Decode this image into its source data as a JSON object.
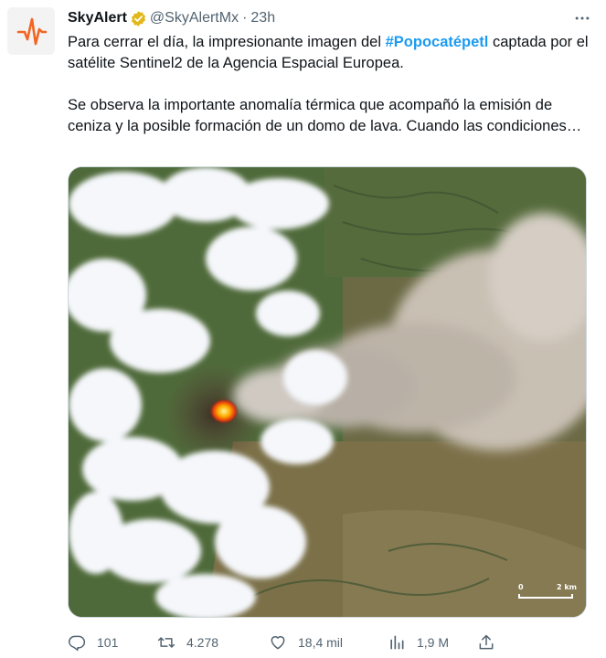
{
  "author": {
    "name": "SkyAlert",
    "handle": "@SkyAlertMx",
    "separator": "·",
    "time": "23h",
    "verified_color": "#e2b719"
  },
  "tweet": {
    "line1_before": "Para cerrar el día, la impresionante imagen del ",
    "hashtag": "#Popocatépetl",
    "line1_after": " captada por el satélite Sentinel2 de la Agencia Espacial Europea.",
    "paragraph2": "Se observa la importante anomalía térmica que acompañó la emisión de ceniza y la posible formación de un domo de lava. Cuando las condiciones…"
  },
  "media": {
    "scale_start": "0",
    "scale_end": "2 km"
  },
  "actions": {
    "replies": "101",
    "reposts": "4.278",
    "likes": "18,4 mil",
    "views": "1,9 M"
  },
  "icons": {
    "reply": "reply-icon",
    "repost": "repost-icon",
    "like": "heart-icon",
    "views": "views-icon",
    "share": "share-icon",
    "more": "more-icon"
  },
  "colors": {
    "text": "#0f1419",
    "secondary": "#536471",
    "link": "#1d9bf0",
    "brand_orange": "#f26522"
  }
}
